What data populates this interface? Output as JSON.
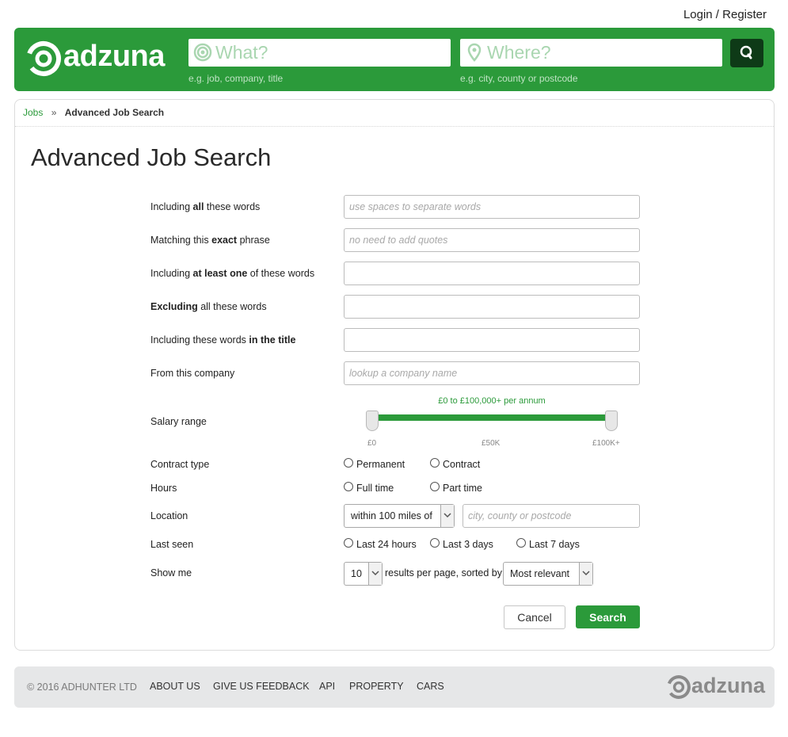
{
  "header": {
    "login_register": "Login / Register",
    "logo_text": "adzuna",
    "what_placeholder": "What?",
    "what_hint": "e.g. job, company, title",
    "where_placeholder": "Where?",
    "where_hint": "e.g. city, county or postcode"
  },
  "breadcrumb": {
    "jobs": "Jobs",
    "separator": "»",
    "current": "Advanced Job Search"
  },
  "page_title": "Advanced Job Search",
  "form": {
    "rows": [
      {
        "pre": "Including ",
        "bold": "all",
        "post": " these words",
        "placeholder": "use spaces to separate words"
      },
      {
        "pre": "Matching this ",
        "bold": "exact",
        "post": " phrase",
        "placeholder": "no need to add quotes"
      },
      {
        "pre": "Including ",
        "bold": "at least one",
        "post": " of these words",
        "placeholder": ""
      },
      {
        "pre": "",
        "bold": "Excluding",
        "post": " all these words",
        "placeholder": ""
      },
      {
        "pre": "Including these words ",
        "bold": "in the title",
        "post": "",
        "placeholder": ""
      },
      {
        "pre": "From this company",
        "bold": "",
        "post": "",
        "placeholder": "lookup a company name"
      }
    ],
    "salary": {
      "label": "Salary range",
      "caption": "£0 to £100,000+ per annum",
      "min_label": "£0",
      "mid_label": "£50K",
      "max_label": "£100K+",
      "range_low": 0,
      "range_high": 1
    },
    "contract_type": {
      "label": "Contract type",
      "options": [
        "Permanent",
        "Contract"
      ]
    },
    "hours": {
      "label": "Hours",
      "options": [
        "Full time",
        "Part time"
      ]
    },
    "location": {
      "label": "Location",
      "distance_selected": "within 100 miles of",
      "placeholder": "city, county or postcode"
    },
    "last_seen": {
      "label": "Last seen",
      "options": [
        "Last 24 hours",
        "Last 3 days",
        "Last 7 days"
      ]
    },
    "show_me": {
      "label": "Show me",
      "per_page": "10",
      "mid_text": "results per page, sorted by",
      "sort_selected": "Most relevant"
    },
    "cancel_label": "Cancel",
    "search_label": "Search"
  },
  "footer": {
    "copyright": "© 2016 ADHUNTER LTD",
    "links": [
      "ABOUT US",
      "GIVE US FEEDBACK",
      "API",
      "PROPERTY",
      "CARS"
    ],
    "logo_text": "adzuna"
  },
  "colors": {
    "brand_green": "#2b9a3a",
    "dark_button": "#0e3a17",
    "footer_bg": "#e6e7e8"
  }
}
